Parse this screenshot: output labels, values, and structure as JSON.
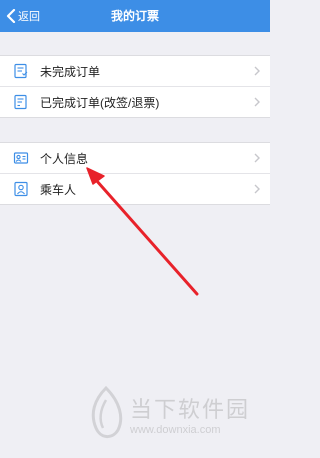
{
  "header": {
    "back_label": "返回",
    "title": "我的订票",
    "background": "#3d8ee6"
  },
  "orders": {
    "items": [
      {
        "label": "未完成订单",
        "icon": "pending-order-icon"
      },
      {
        "label": "已完成订单(改签/退票)",
        "icon": "completed-order-icon"
      }
    ]
  },
  "account": {
    "items": [
      {
        "label": "个人信息",
        "icon": "personal-info-icon"
      },
      {
        "label": "乘车人",
        "icon": "passenger-icon"
      }
    ]
  },
  "annotation": {
    "color": "#e8222a",
    "icon": "red-pointer-arrow"
  },
  "watermark": {
    "text": "当下软件园",
    "url": "www.downxia.com"
  }
}
